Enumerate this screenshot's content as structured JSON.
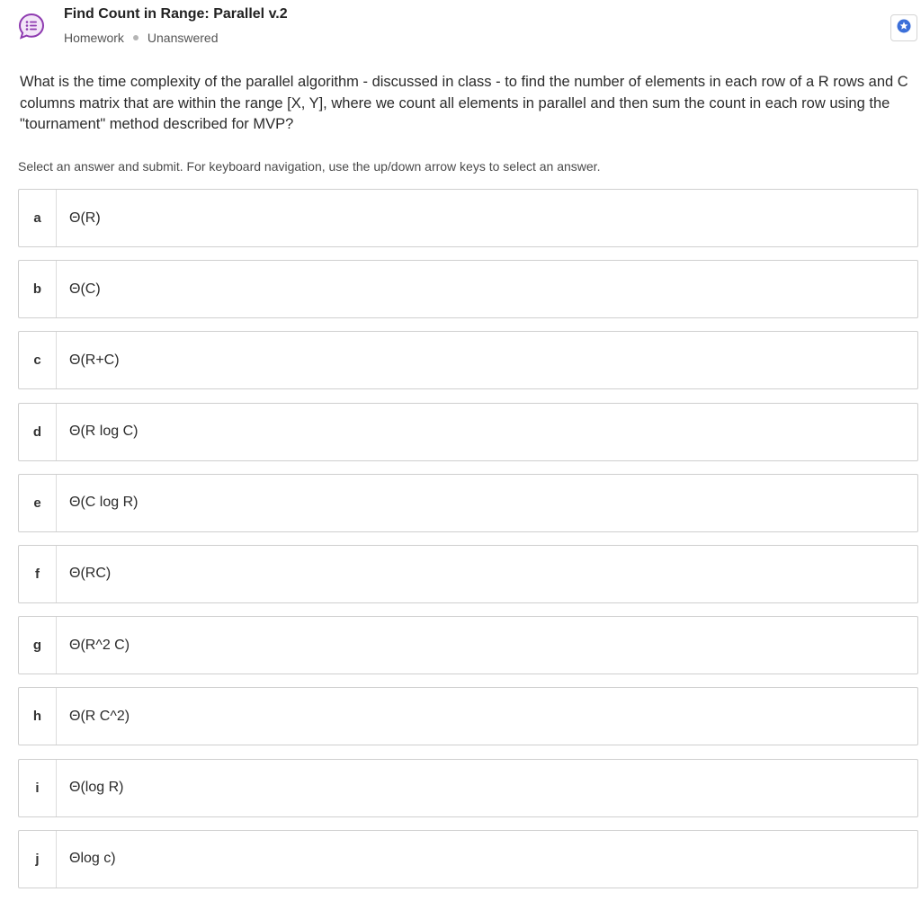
{
  "header": {
    "title": "Find Count in Range: Parallel v.2",
    "category": "Homework",
    "status": "Unanswered",
    "icon": "discussion-bubble-icon",
    "action_icon": "star-badge-icon",
    "colors": {
      "icon_accent": "#8e3ab0",
      "star_badge": "#3b6fd9",
      "dot": "#b5b5b5"
    }
  },
  "question": {
    "text": "What is the time complexity of the parallel algorithm - discussed in class - to find the number of elements in each row of a R rows and C columns matrix that are within the range [X, Y], where we count all elements in parallel and then sum the count in each row using the \"tournament\" method described for MVP?"
  },
  "instructions": "Select an answer and submit. For keyboard navigation, use the up/down arrow keys to select an answer.",
  "options": [
    {
      "letter": "a",
      "text": "Θ(R)"
    },
    {
      "letter": "b",
      "text": "Θ(C)"
    },
    {
      "letter": "c",
      "text": "Θ(R+C)"
    },
    {
      "letter": "d",
      "text": "Θ(R log C)"
    },
    {
      "letter": "e",
      "text": "Θ(C log R)"
    },
    {
      "letter": "f",
      "text": "Θ(RC)"
    },
    {
      "letter": "g",
      "text": "Θ(R^2 C)"
    },
    {
      "letter": "h",
      "text": "Θ(R C^2)"
    },
    {
      "letter": "i",
      "text": "Θ(log R)"
    },
    {
      "letter": "j",
      "text": "Θlog c)"
    }
  ]
}
